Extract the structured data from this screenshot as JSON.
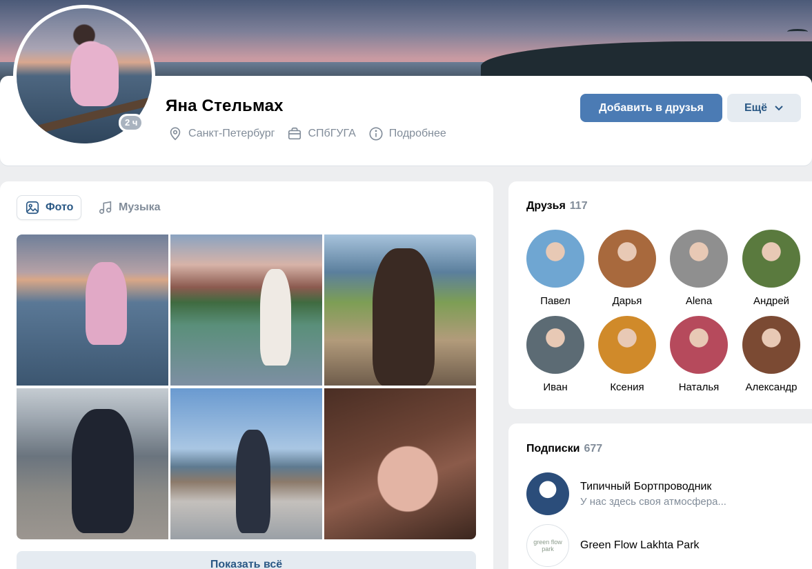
{
  "profile": {
    "name": "Яна Стельмах",
    "online_badge": "2 ч",
    "city": "Санкт-Петербург",
    "university": "СПбГУГА",
    "details_label": "Подробнее",
    "add_friend_label": "Добавить в друзья",
    "more_label": "Ещё"
  },
  "photos": {
    "tabs": [
      {
        "label": "Фото",
        "icon": "image-icon",
        "active": true
      },
      {
        "label": "Музыка",
        "icon": "music-note-icon",
        "active": false
      }
    ],
    "show_all_label": "Показать всё"
  },
  "friends": {
    "title": "Друзья",
    "count": "117",
    "items": [
      {
        "name": "Павел",
        "color": "#6fa6d2"
      },
      {
        "name": "Дарья",
        "color": "#a8693d"
      },
      {
        "name": "Alena",
        "color": "#8f8f8f"
      },
      {
        "name": "Андрей",
        "color": "#5a7a3e"
      },
      {
        "name": "Иван",
        "color": "#5c6b74"
      },
      {
        "name": "Ксения",
        "color": "#d08a2a"
      },
      {
        "name": "Наталья",
        "color": "#b64a5c"
      },
      {
        "name": "Александр",
        "color": "#7b4a33"
      }
    ]
  },
  "subscriptions": {
    "title": "Подписки",
    "count": "677",
    "items": [
      {
        "name": "Типичный Бортпроводник",
        "desc": "У нас здесь своя атмосфера..."
      },
      {
        "name": "Green Flow Lakhta Park",
        "desc": "",
        "logo_text": "green flow park"
      }
    ]
  },
  "colors": {
    "accent": "#4b7bb4",
    "link": "#2a5885",
    "secondary_text": "#818c99",
    "page_bg": "#edeef0"
  }
}
